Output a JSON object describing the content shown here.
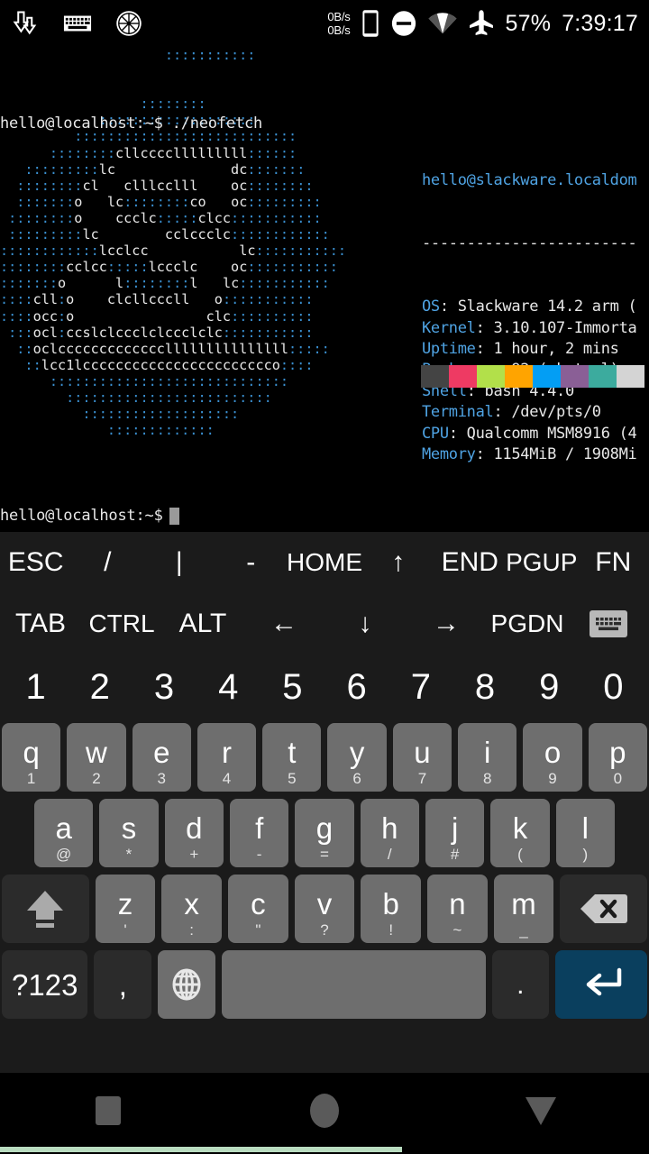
{
  "status_bar": {
    "left_icons": [
      "download-arrows-icon",
      "keyboard-icon",
      "lime-slice-icon"
    ],
    "net_up": "0B/s",
    "net_down": "0B/s",
    "right_icons": [
      "phone-icon",
      "do-not-disturb-icon",
      "wifi-icon",
      "airplane-mode-icon"
    ],
    "battery": "57%",
    "clock": "7:39:17"
  },
  "terminal": {
    "command_line": "hello@localhost:~$ ./neofetch",
    "prompt_line": "hello@localhost:~$",
    "ascii_art": [
      "                    :::::::::::",
      "",
      "",
      "                 ::::::::",
      "            :::::::::::::::::::",
      "         :::::::::::::::::::::::::::",
      "      ::::::::cllcccclllllllll::::::",
      "   :::::::::lc              dc:::::::",
      "  ::::::::cl   clllcclll    oc::::::::",
      "  :::::::o   lc::::::::co   oc:::::::::",
      " ::::::::o    ccclc:::::clcc:::::::::::",
      " :::::::::lc        cclccclc::::::::::::",
      "::::::::::::lcclcc           lc:::::::::::",
      "::::::::cclcc:::::lccclc    oc:::::::::::",
      ":::::::o      l::::::::l   lc:::::::::::",
      "::::cll:o    clcllcccll   o:::::::::::",
      "::::occ:o                clc::::::::::",
      " :::ocl:ccslclccclclccclclc:::::::::::",
      "  ::oclccccccccccccclllllllllllllll:::::",
      "   ::lcc1lccccccccccccccccccccccco::::",
      "      :::::::::::::::::::::::::::::",
      "        :::::::::::::::::::::::::",
      "          :::::::::::::::::::",
      "             :::::::::::::"
    ],
    "info": {
      "header": "hello@slackware.localdom",
      "rule": "------------------------",
      "rows": [
        {
          "key": "OS",
          "value": "Slackware 14.2 arm ("
        },
        {
          "key": "Kernel",
          "value": "3.10.107-Immorta"
        },
        {
          "key": "Uptime",
          "value": "1 hour, 2 mins"
        },
        {
          "key": "Packages",
          "value": "92 (pkgtool)"
        },
        {
          "key": "Shell",
          "value": "bash 4.4.0"
        },
        {
          "key": "Terminal",
          "value": "/dev/pts/0"
        },
        {
          "key": "CPU",
          "value": "Qualcomm MSM8916 (4"
        },
        {
          "key": "Memory",
          "value": "1154MiB / 1908Mi"
        }
      ]
    },
    "palette_colors": [
      "#444444",
      "#ee3a63",
      "#b2e04a",
      "#ffa400",
      "#039ef4",
      "#8a5f96",
      "#3cab9e",
      "#d4d4d4"
    ],
    "label_color": "#4fa3e3",
    "text_color": "#e8e8e8",
    "art_color": "#3a8fd0"
  },
  "keyboard": {
    "fn_row_1": [
      "ESC",
      "/",
      "|",
      "-",
      "HOME",
      "↑",
      "END",
      "PGUP",
      "FN"
    ],
    "fn_row_2": [
      "TAB",
      "CTRL",
      "ALT",
      "←",
      "↓",
      "→",
      "PGDN",
      "keyboard-icon"
    ],
    "number_row": [
      "1",
      "2",
      "3",
      "4",
      "5",
      "6",
      "7",
      "8",
      "9",
      "0"
    ],
    "row_qwerty": [
      {
        "main": "q",
        "sub": "1"
      },
      {
        "main": "w",
        "sub": "2"
      },
      {
        "main": "e",
        "sub": "3"
      },
      {
        "main": "r",
        "sub": "4"
      },
      {
        "main": "t",
        "sub": "5"
      },
      {
        "main": "y",
        "sub": "6"
      },
      {
        "main": "u",
        "sub": "7"
      },
      {
        "main": "i",
        "sub": "8"
      },
      {
        "main": "o",
        "sub": "9"
      },
      {
        "main": "p",
        "sub": "0"
      }
    ],
    "row_asdf": [
      {
        "main": "a",
        "sub": "@"
      },
      {
        "main": "s",
        "sub": "*"
      },
      {
        "main": "d",
        "sub": "+"
      },
      {
        "main": "f",
        "sub": "-"
      },
      {
        "main": "g",
        "sub": "="
      },
      {
        "main": "h",
        "sub": "/"
      },
      {
        "main": "j",
        "sub": "#"
      },
      {
        "main": "k",
        "sub": "("
      },
      {
        "main": "l",
        "sub": ")"
      }
    ],
    "row_zxcv": [
      {
        "main": "z",
        "sub": "'"
      },
      {
        "main": "x",
        "sub": ":"
      },
      {
        "main": "c",
        "sub": "\""
      },
      {
        "main": "v",
        "sub": "?"
      },
      {
        "main": "b",
        "sub": "!"
      },
      {
        "main": "n",
        "sub": "~"
      },
      {
        "main": "m",
        "sub": "_"
      }
    ],
    "shift_label": "shift-icon",
    "backspace_label": "backspace-icon",
    "bottom_row": {
      "symbols_label": "?123",
      "comma_label": ",",
      "globe_label": "globe-icon",
      "space_label": "",
      "period_label": ".",
      "enter_label": "enter-icon"
    },
    "enter_color": "#0a3f5e",
    "key_color": "#6e6e6e",
    "dark_key_color": "#2b2b2b"
  },
  "nav_bar": {
    "items": [
      "recents-square-icon",
      "home-circle-icon",
      "hide-keyboard-triangle-icon"
    ]
  },
  "bottom_progress": {
    "percent": 62,
    "color": "#b9dcc0"
  }
}
